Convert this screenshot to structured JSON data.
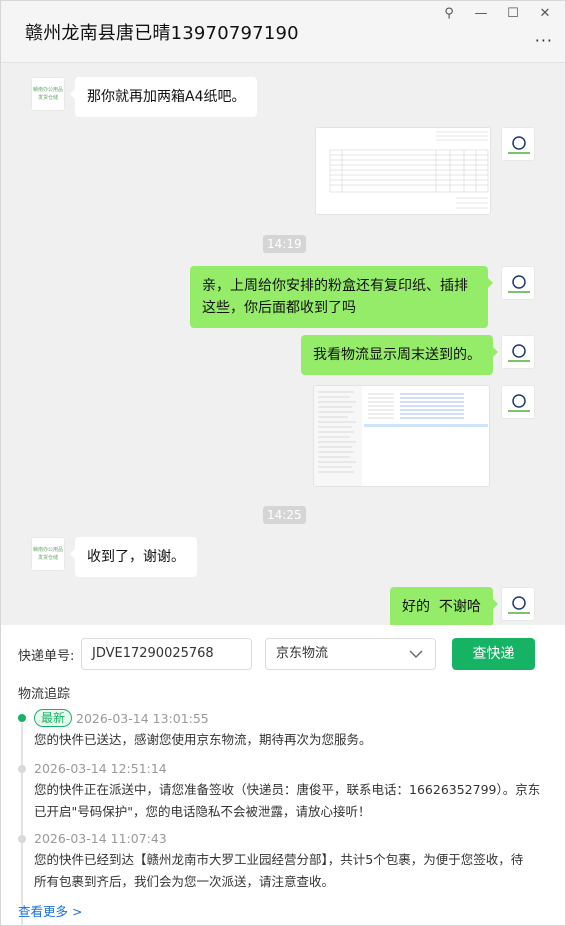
{
  "window": {
    "title": "赣州龙南县唐已晴13970797190",
    "pin_glyph": "⚲",
    "min_glyph": "—",
    "max_glyph": "☐",
    "close_glyph": "✕",
    "more_glyph": "···"
  },
  "chat": {
    "messages": [
      {
        "text": "那你就再加两箱A4纸吧。"
      },
      {
        "text": "亲，上周给你安排的粉盒还有复印纸、插排这些，你后面都收到了吗"
      },
      {
        "text": "我看物流显示周末送到的。"
      },
      {
        "text": "收到了，谢谢。"
      },
      {
        "text": "好的  不谢哈"
      }
    ],
    "times": [
      "14:19",
      "14:25"
    ],
    "shop_avatar_lines": [
      "赣南办公用品",
      "发货仓储"
    ]
  },
  "tracking": {
    "number_label": "快递单号:",
    "number_value": "JDVE17290025768",
    "carrier": "京东物流",
    "query_button": "查快递",
    "section_title": "物流追踪",
    "latest_badge": "最新",
    "events": [
      {
        "time": "2026-03-14 13:01:55",
        "desc": "您的快件已送达，感谢您使用京东物流，期待再次为您服务。"
      },
      {
        "time": "2026-03-14 12:51:14",
        "desc_line1": "您的快件正在派送中，请您准备签收（快递员：唐俊平，联系电话：16626352799）。京东",
        "desc_line2": "已开启\"号码保护\"，您的电话隐私不会被泄露，请放心接听！"
      },
      {
        "time": "2026-03-14 11:07:43",
        "desc_line1": "您的快件已经到达【赣州龙南市大罗工业园经营分部】，共计5个包裹，为便于您签收，待",
        "desc_line2": "所有包裹到齐后，我们会为您一次派送，请注意查收。"
      }
    ],
    "more_link": "查看更多 >"
  },
  "colors": {
    "accent_green": "#16b364",
    "bubble_green": "#95ec69",
    "chat_bg": "#f0f0f0"
  }
}
